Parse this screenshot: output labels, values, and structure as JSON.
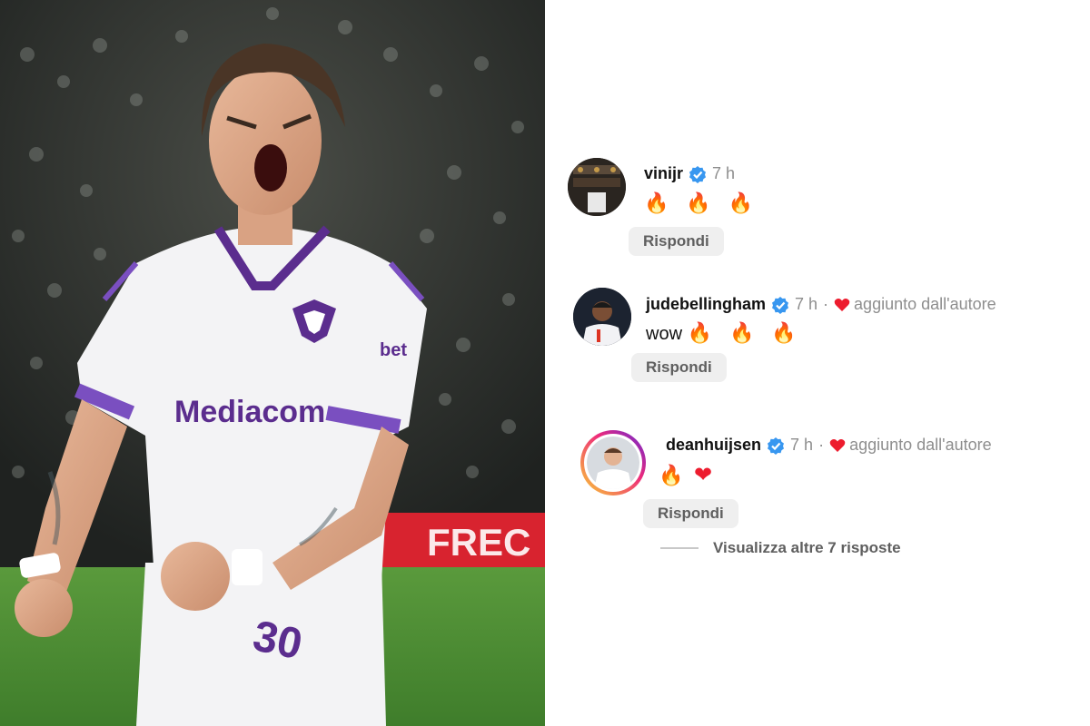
{
  "comments": [
    {
      "username": "vinijr",
      "time": "7 h",
      "text": "🔥 🔥 🔥",
      "reply_label": "Rispondi",
      "liked_by_author": false
    },
    {
      "username": "judebellingham",
      "time": "7 h",
      "separator": "·",
      "liked_label": "aggiunto dall'autore",
      "text_word": "wow",
      "text_emoji": "🔥 🔥 🔥",
      "reply_label": "Rispondi",
      "liked_by_author": true
    },
    {
      "username": "deanhuijsen",
      "time": "7 h",
      "separator": "·",
      "liked_label": "aggiunto dall'autore",
      "text_fire": "🔥",
      "text_heart": "❤",
      "reply_label": "Rispondi",
      "liked_by_author": true,
      "is_reply": true
    }
  ],
  "view_more_replies": "Visualizza altre 7 risposte",
  "photo": {
    "jersey_sponsor": "Mediacom",
    "sleeve_sponsor": "bet",
    "number": "30",
    "ad_board_text": "FREC"
  },
  "colors": {
    "verified_blue": "#3897f0",
    "heart_red": "#ed1c2e",
    "fiorentina_purple": "#5b2d8e",
    "story_ring_start": "#f9ce34",
    "story_ring_end": "#ee2a7b"
  },
  "icons": [
    "verified-badge-icon",
    "heart-icon",
    "fire-emoji"
  ]
}
